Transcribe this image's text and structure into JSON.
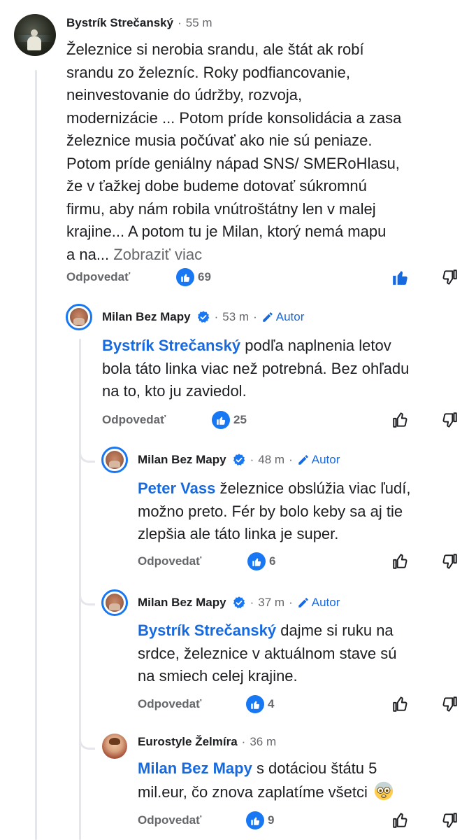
{
  "comments": [
    {
      "author": "Bystrík Strečanský",
      "time": "55 m",
      "lines": [
        "Železnice si nerobia srandu, ale štát ak robí",
        "srandu zo železníc. Roky podfiancovanie,",
        "neinvestovanie do údržby, rozvoja,",
        "modernizácie ... Potom príde konsolidácia a zasa",
        "železnice musia počúvať ako nie sú peniaze.",
        "Potom príde geniálny nápad SNS/ SMERoHlasu,",
        "že v ťažkej dobe budeme dotovať súkromnú",
        "firmu, aby nám robila vnútroštátny len v malej",
        "krajine... A potom tu je Milan, ktorý nemá mapu"
      ],
      "last_line": "a na...",
      "see_more": "Zobraziť viac",
      "reply_label": "Odpovedať",
      "likes": "69",
      "liked": true
    },
    {
      "author": "Milan Bez Mapy",
      "time": "53 m",
      "badge": "Autor",
      "mention": "Bystrík Strečanský",
      "lines": [
        "podľa naplnenia letov",
        "bola táto linka viac než potrebná. Bez ohľadu",
        "na to, kto ju zaviedol."
      ],
      "reply_label": "Odpovedať",
      "likes": "25"
    },
    {
      "author": "Milan Bez Mapy",
      "time": "48 m",
      "badge": "Autor",
      "mention": "Peter Vass",
      "lines": [
        "železnice obslúžia viac ľudí,",
        "možno preto. Fér by bolo keby sa aj tie",
        "zlepšia ale táto linka je super."
      ],
      "reply_label": "Odpovedať",
      "likes": "6"
    },
    {
      "author": "Milan Bez Mapy",
      "time": "37 m",
      "badge": "Autor",
      "mention": "Bystrík Strečanský",
      "lines": [
        "dajme si ruku na",
        "srdce, železnice v aktuálnom stave sú",
        "na smiech celej krajine."
      ],
      "reply_label": "Odpovedať",
      "likes": "4"
    },
    {
      "author": "Eurostyle Želmíra",
      "time": "36 m",
      "mention": "Milan Bez Mapy",
      "lines": [
        "s dotáciou štátu 5",
        "mil.eur, čo znova zaplatíme všetci"
      ],
      "emoji": "flushed-face",
      "reply_label": "Odpovedať",
      "likes": "9"
    }
  ],
  "colors": {
    "accent": "#1877f2",
    "mention": "#1769e0",
    "muted": "#65676b",
    "thread_line": "#e4e6eb"
  }
}
